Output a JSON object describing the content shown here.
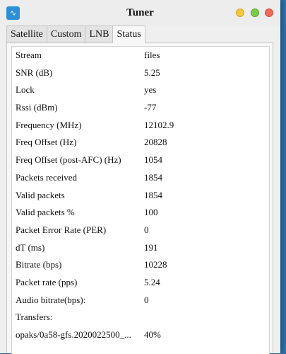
{
  "window": {
    "title": "Tuner",
    "app_icon": "waveform-icon"
  },
  "tabs": [
    {
      "label": "Satellite",
      "active": false
    },
    {
      "label": "Custom",
      "active": false
    },
    {
      "label": "LNB",
      "active": false
    },
    {
      "label": "Status",
      "active": true
    }
  ],
  "status": {
    "rows": [
      {
        "key": "Stream",
        "value": "files"
      },
      {
        "key": "SNR (dB)",
        "value": "5.25"
      },
      {
        "key": "Lock",
        "value": "yes"
      },
      {
        "key": "Rssi (dBm)",
        "value": "-77"
      },
      {
        "key": "Frequency (MHz)",
        "value": "12102.9"
      },
      {
        "key": "Freq Offset (Hz)",
        "value": "20828"
      },
      {
        "key": "Freq Offset (post-AFC) (Hz)",
        "value": "1054"
      },
      {
        "key": "Packets received",
        "value": "1854"
      },
      {
        "key": "Valid packets",
        "value": "1854"
      },
      {
        "key": "Valid packets %",
        "value": "100"
      },
      {
        "key": "Packet Error Rate (PER)",
        "value": "0"
      },
      {
        "key": "dT (ms)",
        "value": "191"
      },
      {
        "key": "Bitrate (bps)",
        "value": "10228"
      },
      {
        "key": "Packet rate (pps)",
        "value": "5.24"
      },
      {
        "key": "Audio bitrate(bps):",
        "value": "0"
      },
      {
        "key": "Transfers:",
        "value": ""
      },
      {
        "key": "opaks/0a58-gfs.2020022500_...",
        "value": "40%"
      }
    ]
  }
}
